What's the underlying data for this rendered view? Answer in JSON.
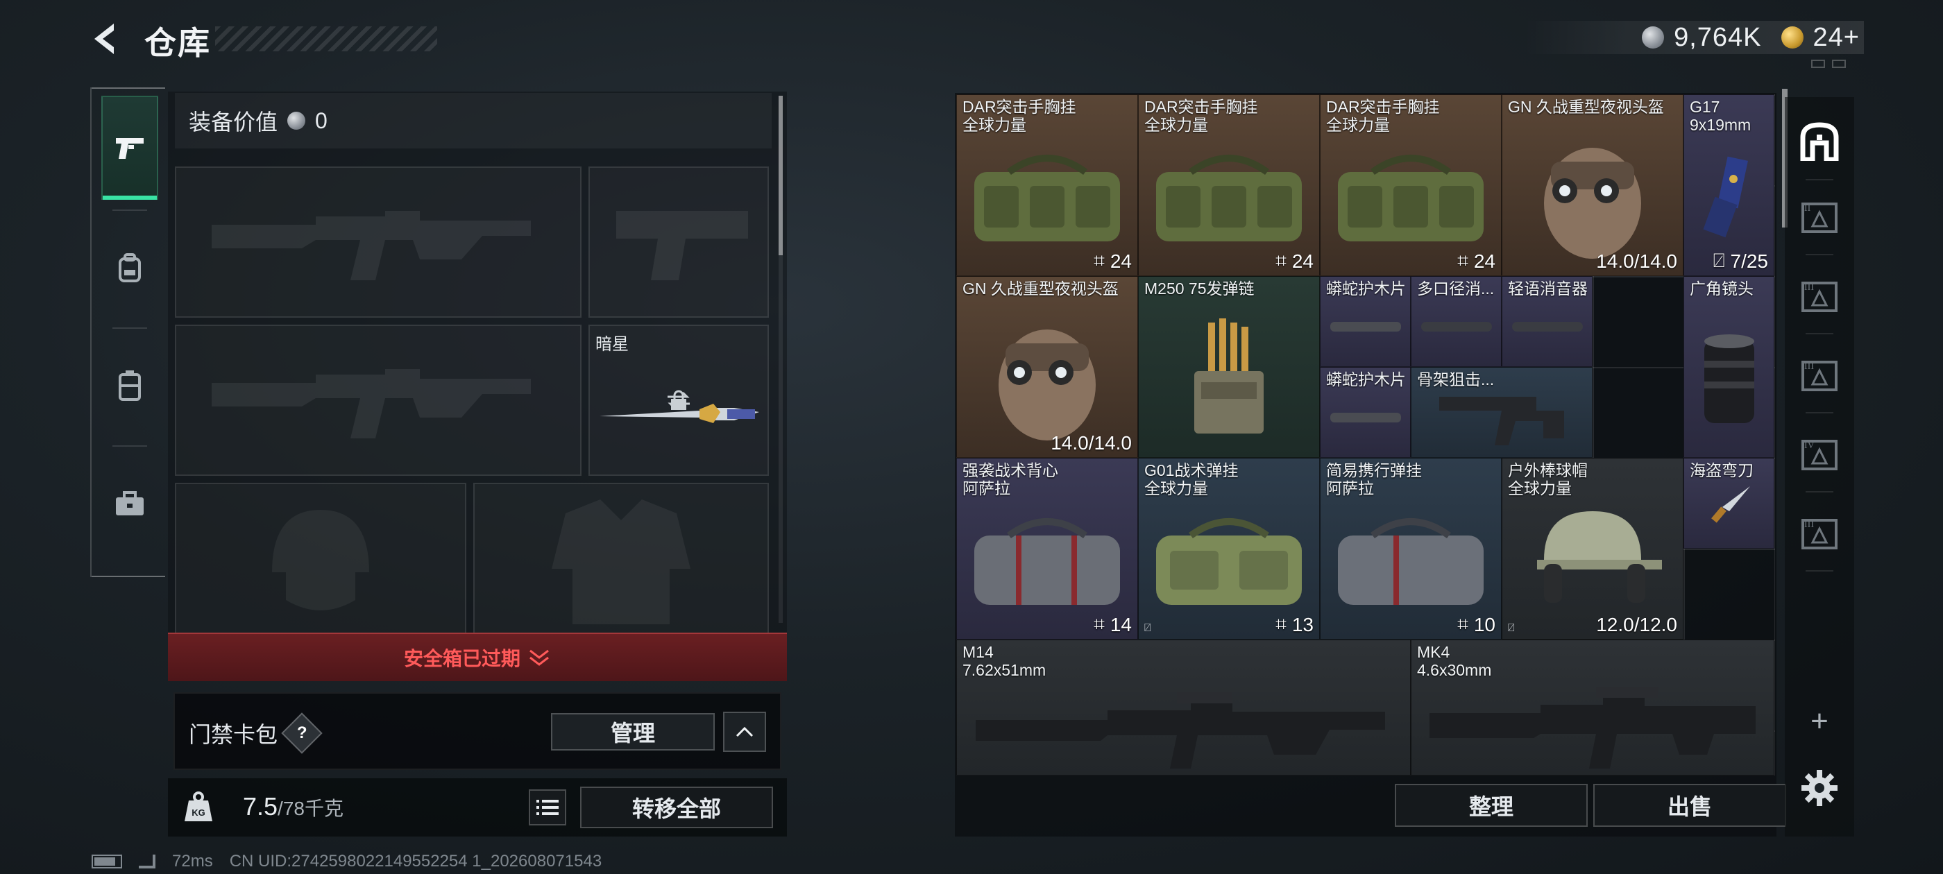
{
  "header": {
    "title": "仓库",
    "currency_silver": "9,764K",
    "currency_gold": "24+"
  },
  "loadout": {
    "value_label": "装备价值",
    "value": "0",
    "melee_slot_label": "暗星",
    "expired_text": "安全箱已过期",
    "keycard_label": "门禁卡包",
    "keycard_help": "?",
    "manage_label": "管理",
    "weight_value": "7.5",
    "weight_max": "/78千克",
    "transfer_all_label": "转移全部"
  },
  "status": {
    "ping": "72ms",
    "uid": "CN UID:2742598022149552254 1_202608071543"
  },
  "stash": {
    "items": [
      {
        "name1": "DAR突击手胸挂",
        "name2": "全球力量",
        "count": "24"
      },
      {
        "name1": "DAR突击手胸挂",
        "name2": "全球力量",
        "count": "24"
      },
      {
        "name1": "DAR突击手胸挂",
        "name2": "全球力量",
        "count": "24"
      },
      {
        "name1": "GN 久战重型夜视头盔",
        "durability": "14.0/14.0"
      },
      {
        "name1": "G17",
        "name2": "9x19mm",
        "ammo": "7/25"
      },
      {
        "name1": "GN 久战重型夜视头盔",
        "durability": "14.0/14.0"
      },
      {
        "name1": "M250 75发弹链"
      },
      {
        "name1": "蟒蛇护木片"
      },
      {
        "name1": "多口径消..."
      },
      {
        "name1": "轻语消音器"
      },
      {
        "name1": "广角镜头"
      },
      {
        "name1": "蟒蛇护木片"
      },
      {
        "name1": "骨架狙击..."
      },
      {
        "name1": "强袭战术背心",
        "name2": "阿萨拉",
        "count": "14"
      },
      {
        "name1": "G01战术弹挂",
        "name2": "全球力量",
        "count": "13"
      },
      {
        "name1": "简易携行弹挂",
        "name2": "阿萨拉",
        "count": "10"
      },
      {
        "name1": "户外棒球帽",
        "name2": "全球力量",
        "durability": "12.0/12.0"
      },
      {
        "name1": "海盗弯刀"
      },
      {
        "name1": "M14",
        "name2": "7.62x51mm"
      },
      {
        "name1": "MK4",
        "name2": "4.6x30mm"
      }
    ],
    "sort_label": "整理",
    "sell_label": "出售"
  },
  "pages": {
    "tab2": "II",
    "tab3": "III",
    "tab4": "III",
    "tab5": "IV",
    "tab6": "III",
    "add": "+"
  },
  "colors": {
    "accent_green": "#39e3a4",
    "expired_red": "#ff5a5a",
    "quality_brown": "#5a4636",
    "quality_green": "#283a34",
    "quality_blue": "#2e3d4c",
    "quality_purple": "#3b3a55"
  }
}
